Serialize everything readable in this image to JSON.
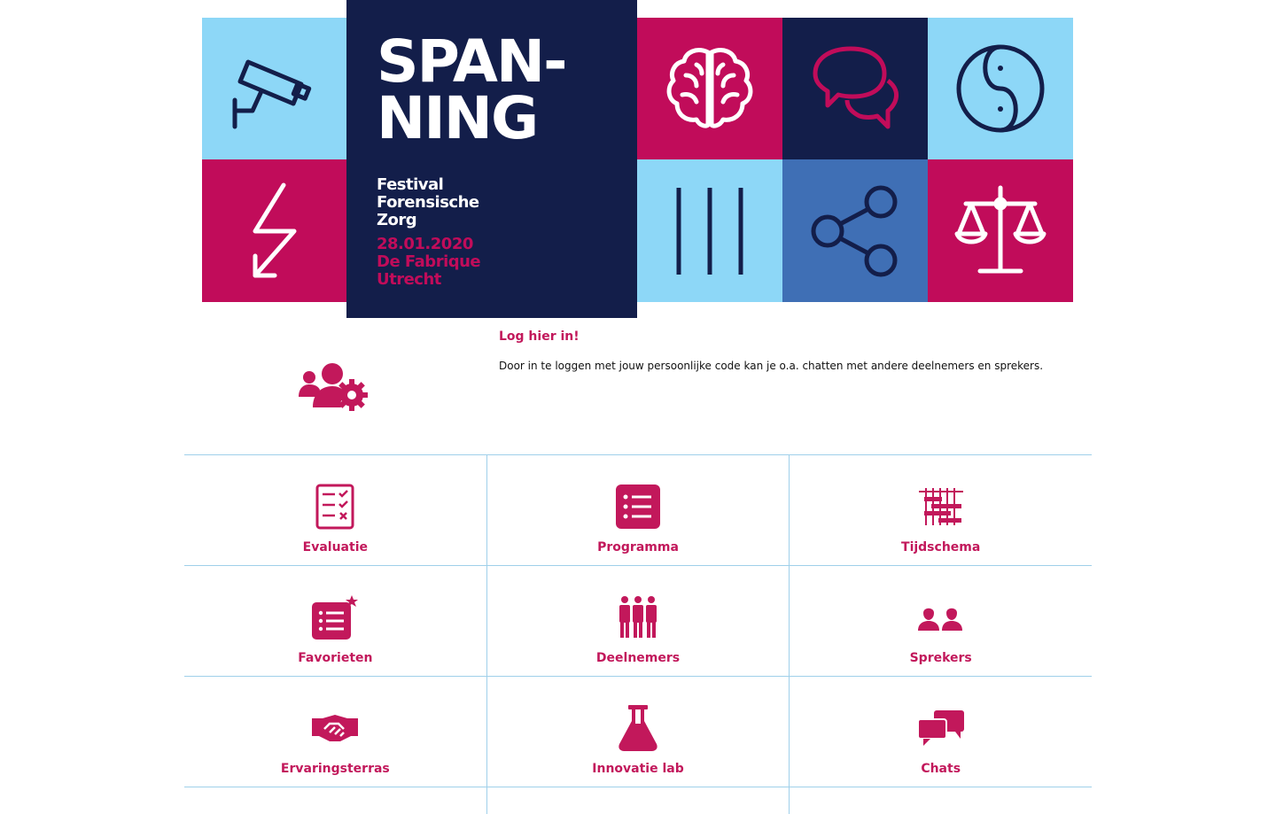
{
  "banner": {
    "title_line1": "SPAN-",
    "title_line2": "NING",
    "subtitle_lines": [
      "Festival",
      "Forensische",
      "Zorg"
    ],
    "event_lines": [
      "28.01.2020",
      "De Fabrique",
      "Utrecht"
    ],
    "colors": {
      "navy": "#131e4a",
      "magenta": "#c10c5a",
      "light_blue": "#8dd7f7",
      "mid_blue": "#3f6fb5"
    },
    "tiles": [
      {
        "icon": "security-camera-icon"
      },
      {
        "icon": "lightning-arrow-icon"
      },
      {
        "icon": "brain-icon"
      },
      {
        "icon": "chat-bubbles-icon"
      },
      {
        "icon": "yin-yang-icon"
      },
      {
        "icon": "prison-bars-icon"
      },
      {
        "icon": "share-icon"
      },
      {
        "icon": "scales-of-justice-icon"
      }
    ]
  },
  "login": {
    "icon": "users-gear-icon",
    "heading": "Log hier in!",
    "text": "Door in te loggen met jouw persoonlijke code kan je o.a. chatten met andere deelnemers en sprekers."
  },
  "menu": {
    "accent_color": "#c2185b",
    "border_color": "#9fd0ea",
    "items": [
      {
        "label": "Evaluatie",
        "icon": "evaluation-checklist-icon"
      },
      {
        "label": "Programma",
        "icon": "program-list-icon"
      },
      {
        "label": "Tijdschema",
        "icon": "schedule-grid-icon"
      },
      {
        "label": "Favorieten",
        "icon": "favorites-list-star-icon"
      },
      {
        "label": "Deelnemers",
        "icon": "participants-group-icon"
      },
      {
        "label": "Sprekers",
        "icon": "speakers-icon"
      },
      {
        "label": "Ervaringsterras",
        "icon": "handshake-icon"
      },
      {
        "label": "Innovatie lab",
        "icon": "flask-icon"
      },
      {
        "label": "Chats",
        "icon": "chat-icon"
      }
    ]
  }
}
